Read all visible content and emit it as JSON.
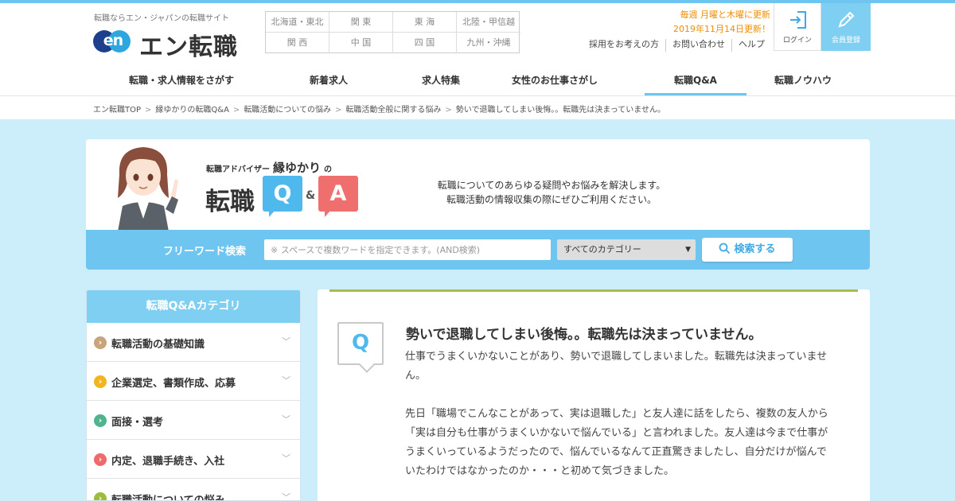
{
  "header": {
    "tagline": "転職ならエン・ジャパンの転職サイト",
    "logo_mark": "en",
    "logo_text": "エン転職",
    "regions": [
      "北海道・東北",
      "関 東",
      "東 海",
      "北陸・甲信越",
      "関 西",
      "中 国",
      "四 国",
      "九州・沖縄"
    ],
    "update_line1": "毎週 月曜と木曜に更新",
    "update_line2": "2019年11月14日更新！",
    "sublinks": [
      "採用をお考えの方",
      "お問い合わせ",
      "ヘルプ"
    ],
    "login_label": "ログイン",
    "register_label": "会員登録"
  },
  "gnav": {
    "items": [
      {
        "label": "転職・求人情報をさがす"
      },
      {
        "label": "新着求人"
      },
      {
        "label": "求人特集"
      },
      {
        "label": "女性のお仕事さがし"
      },
      {
        "label": "転職Q&A"
      },
      {
        "label": "転職ノウハウ"
      }
    ],
    "active_index": 4
  },
  "breadcrumb": [
    "エン転職TOP",
    "縁ゆかりの転職Q&A",
    "転職活動についての悩み",
    "転職活動全般に関する悩み",
    "勢いで退職してしまい後悔。。転職先は決まっていません。"
  ],
  "hero": {
    "advisor_prefix": "転職アドバイザー",
    "advisor_name": "縁ゆかり",
    "advisor_suffix": "の",
    "title": "転職",
    "badge_q": "Q",
    "badge_amp": "&",
    "badge_a": "A",
    "desc_line1": "転職についてのあらゆる疑問やお悩みを解決します。",
    "desc_line2": "転職活動の情報収集の際にぜひご利用ください。"
  },
  "search": {
    "label": "フリーワード検索",
    "placeholder": "※ スペースで複数ワードを指定できます。(AND検索)",
    "category_selected": "すべてのカテゴリー",
    "button_label": "検索する"
  },
  "sidebar": {
    "title": "転職Q&Aカテゴリ",
    "items": [
      {
        "label": "転職活動の基礎知識",
        "color": "#c9a37a"
      },
      {
        "label": "企業選定、書類作成、応募",
        "color": "#f3b51d"
      },
      {
        "label": "面接・選考",
        "color": "#4fb48e"
      },
      {
        "label": "内定、退職手続き、入社",
        "color": "#ef6a6a"
      },
      {
        "label": "転職活動についての悩み",
        "color": "#9dbb3c"
      }
    ]
  },
  "question": {
    "badge": "Q",
    "title": "勢いで退職してしまい後悔。。転職先は決まっていません。",
    "paragraph1": "仕事でうまくいかないことがあり、勢いで退職してしまいました。転職先は決まっていません。",
    "paragraph2": "先日「職場でこんなことがあって、実は退職した」と友人達に話をしたら、複数の友人から「実は自分も仕事がうまくいかないで悩んでいる」と言われました。友人達は今まで仕事がうまくいっているようだったので、悩んでいるなんて正直驚きましたし、自分だけが悩んでいたわけではなかったのか・・・と初めて気づきました。"
  }
}
